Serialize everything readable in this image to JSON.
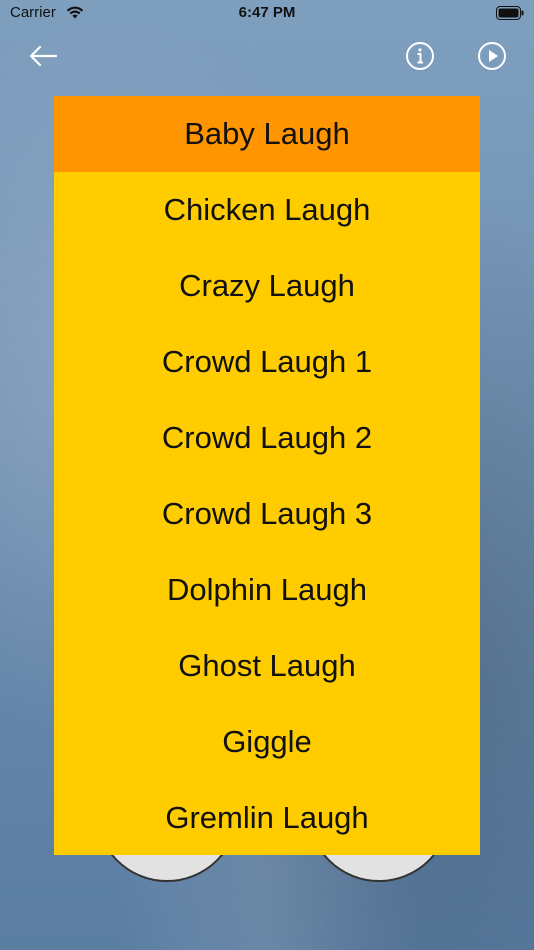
{
  "status_bar": {
    "carrier": "Carrier",
    "time": "6:47 PM"
  },
  "toolbar": {
    "back_icon": "arrow-left-icon",
    "info_icon": "info-circle-icon",
    "play_icon": "play-circle-icon"
  },
  "colors": {
    "list_background": "#ffcc00",
    "selected_background": "#ff9500",
    "icon_color": "#ffffff"
  },
  "sound_list": {
    "selected_index": 0,
    "items": [
      {
        "label": "Baby Laugh"
      },
      {
        "label": "Chicken Laugh"
      },
      {
        "label": "Crazy Laugh"
      },
      {
        "label": "Crowd Laugh 1"
      },
      {
        "label": "Crowd Laugh 2"
      },
      {
        "label": "Crowd Laugh 3"
      },
      {
        "label": "Dolphin Laugh"
      },
      {
        "label": "Ghost Laugh"
      },
      {
        "label": "Giggle"
      },
      {
        "label": "Gremlin Laugh"
      }
    ]
  }
}
